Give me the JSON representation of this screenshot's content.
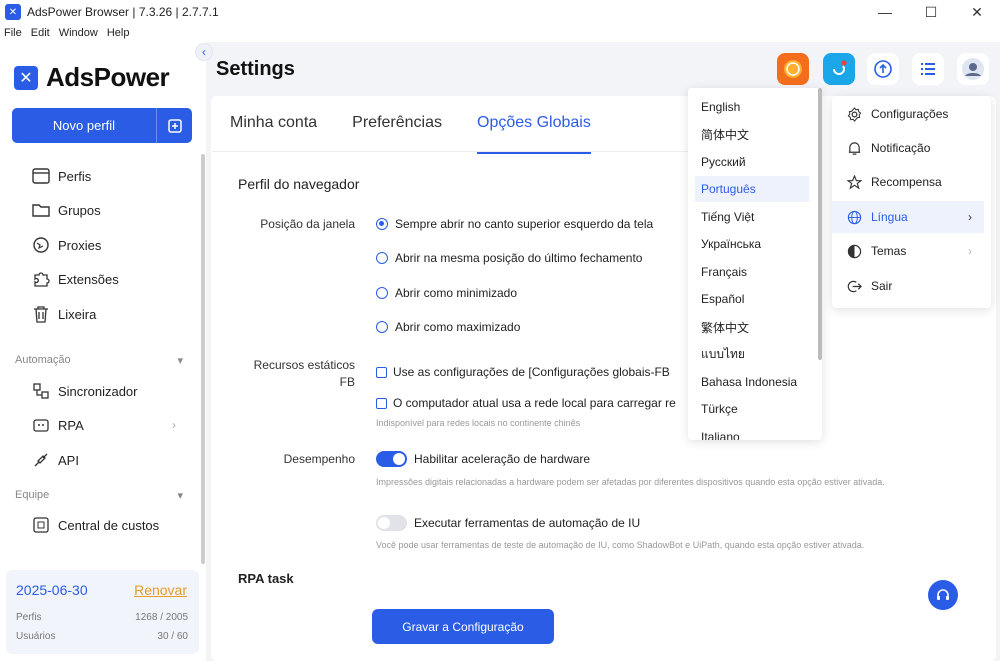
{
  "window": {
    "title": "AdsPower Browser | 7.3.26 | 2.7.7.1",
    "controls": {
      "minimize": "—",
      "maximize": "☐",
      "close": "✕"
    }
  },
  "menu": [
    "File",
    "Edit",
    "Window",
    "Help"
  ],
  "sidebar": {
    "logo": "AdsPower",
    "new_profile": "Novo perfil",
    "items": [
      {
        "label": "Perfis",
        "icon": "profiles-icon"
      },
      {
        "label": "Grupos",
        "icon": "folder-icon"
      },
      {
        "label": "Proxies",
        "icon": "proxy-icon"
      },
      {
        "label": "Extensões",
        "icon": "extension-icon"
      },
      {
        "label": "Lixeira",
        "icon": "trash-icon"
      }
    ],
    "automation_label": "Automação",
    "automation_items": [
      {
        "label": "Sincronizador",
        "icon": "sync-icon"
      },
      {
        "label": "RPA",
        "icon": "robot-icon"
      },
      {
        "label": "API",
        "icon": "api-icon"
      }
    ],
    "team_label": "Equipe",
    "team_items": [
      {
        "label": "Central de custos",
        "icon": "cost-icon"
      }
    ],
    "plan": {
      "date": "2025-06-30",
      "renew": "Renovar",
      "profiles_label": "Perfis",
      "profiles_value": "1268 / 2005",
      "users_label": "Usuários",
      "users_value": "30 / 60"
    }
  },
  "page": {
    "title": "Settings",
    "tabs": [
      "Minha conta",
      "Preferências",
      "Opções Globais"
    ],
    "active_tab": 2,
    "browser_section": "Perfil do navegador",
    "window_position_label": "Posição da janela",
    "window_options": [
      "Sempre abrir no canto superior esquerdo da tela",
      "Abrir na mesma posição do último fechamento",
      "Abrir como minimizado",
      "Abrir como maximizado"
    ],
    "static_resources_label": "Recursos estáticos FB",
    "static_options": [
      "Use as configurações de [Configurações globais-FB",
      "O computador atual usa a rede local para carregar re"
    ],
    "static_hint": "Indisponível para redes locais no continente chinês",
    "performance_label": "Desempenho",
    "hw_accel_label": "Habilitar aceleração de hardware",
    "hw_accel_hint": "Impressões digitais relacionadas a hardware podem ser afetadas por diferentes dispositivos quando esta opção estiver ativada.",
    "ui_auto_label": "Executar ferramentas de automação de IU",
    "ui_auto_hint": "Você pode usar ferramentas de teste de automação de IU, como ShadowBot e UiPath, quando esta opção estiver ativada.",
    "rpa_section": "RPA task",
    "save_button": "Gravar a Configuração"
  },
  "language_menu": {
    "items": [
      "English",
      "简体中文",
      "Русский",
      "Português",
      "Tiếng Việt",
      "Українська",
      "Français",
      "Español",
      "繁体中文",
      "แบบไทย",
      "Bahasa Indonesia",
      "Türkçe",
      "Italiano"
    ],
    "selected": "Português"
  },
  "user_menu": {
    "items": [
      {
        "label": "Configurações",
        "icon": "gear-icon"
      },
      {
        "label": "Notificação",
        "icon": "bell-icon"
      },
      {
        "label": "Recompensa",
        "icon": "star-icon"
      },
      {
        "label": "Língua",
        "icon": "globe-icon"
      },
      {
        "label": "Temas",
        "icon": "theme-icon"
      },
      {
        "label": "Sair",
        "icon": "logout-icon"
      }
    ]
  },
  "colors": {
    "accent": "#2b5ce6",
    "renew": "#e89a2a"
  }
}
